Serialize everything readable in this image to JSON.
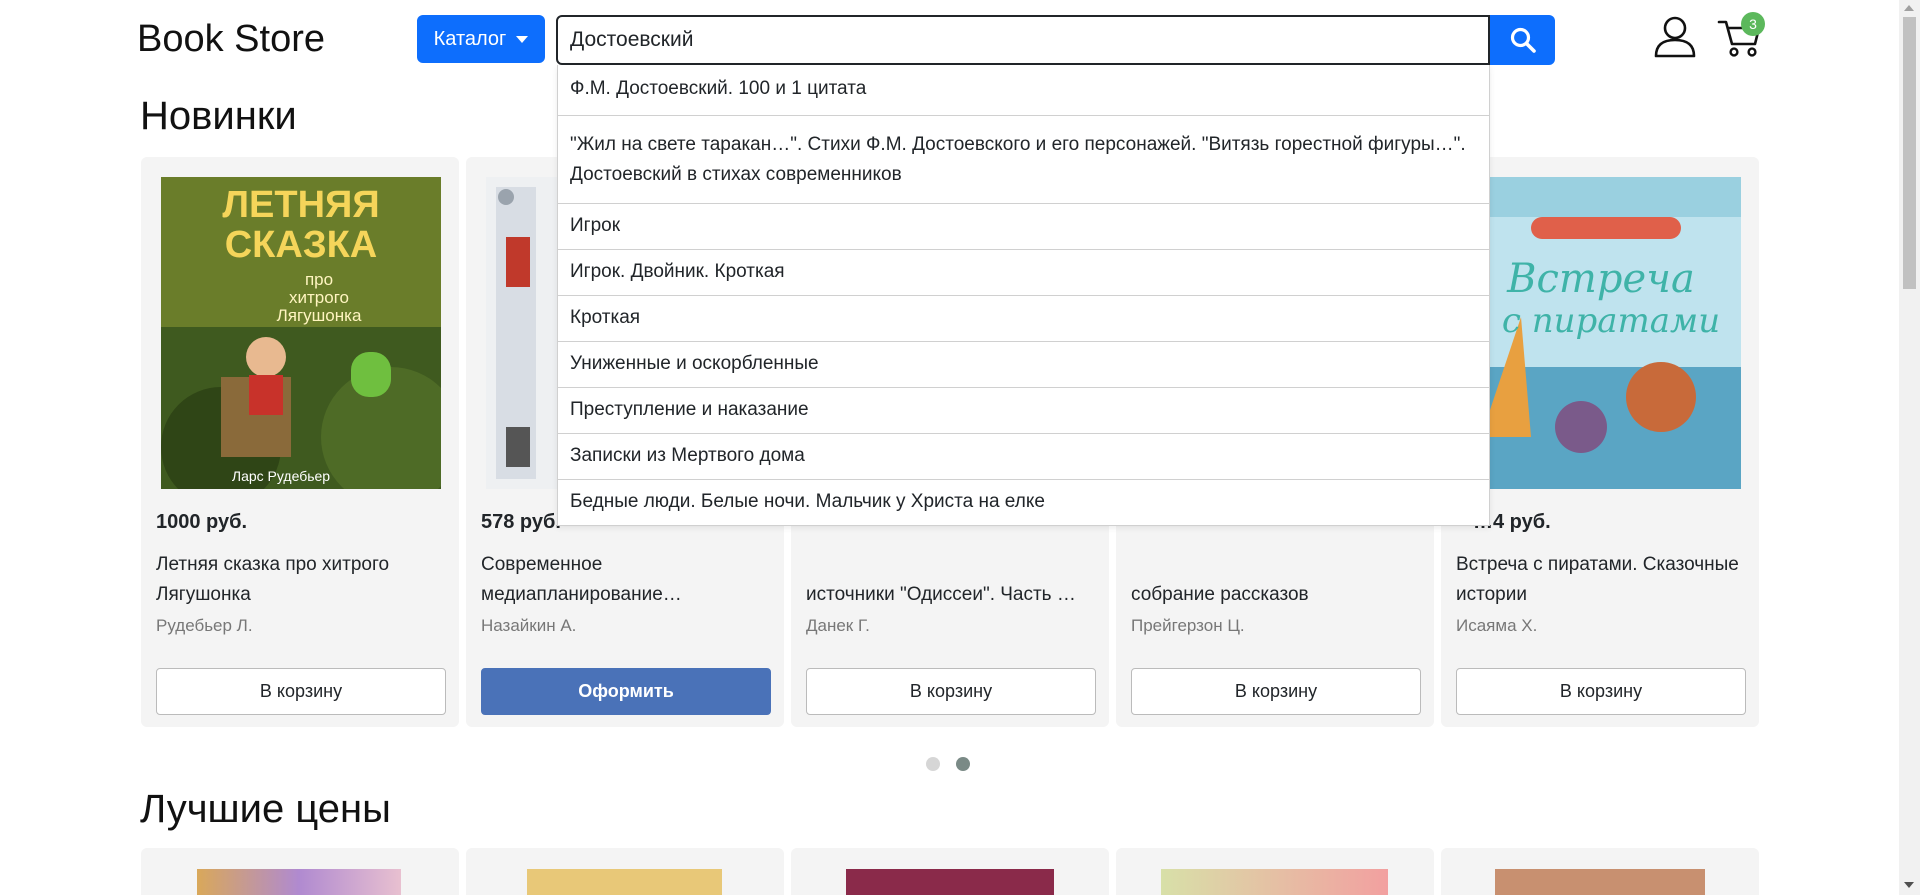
{
  "header": {
    "logo": "Book Store",
    "catalog_label": "Каталог",
    "search_value": "Достоевский",
    "cart_count": "3"
  },
  "sections": {
    "new_title": "Новинки",
    "best_prices_title": "Лучшие цены"
  },
  "products": [
    {
      "price": "1000 руб.",
      "title": "Летняя сказка про хитрого Лягушонка",
      "author": "Рудебьер Л.",
      "button": "В корзину",
      "cover_lines": [
        "ЛЕТНЯЯ",
        "СКАЗКА",
        "про",
        "хитрого",
        "Лягушонка",
        "Ларс Рудебьер"
      ]
    },
    {
      "price": "578 руб.",
      "title": "Современное медиапланирование…",
      "author": "Назайкин А.",
      "button": "Оформить"
    },
    {
      "price": "",
      "title": "",
      "author": "Данек Г.",
      "button": "В корзину"
    },
    {
      "price": "",
      "title": "",
      "author": "Прейгерзон Ц.",
      "button": "В корзину"
    },
    {
      "price": "…4 руб.",
      "title": "Встреча с пиратами. Сказочные истории",
      "author": "Исаяма Х.",
      "button": "В корзину",
      "cover_lines": [
        "Встреча",
        "с пиратами"
      ]
    }
  ],
  "partial_titles": {
    "card3": "источники \"Одиссеи\". Часть …",
    "card4": "собрание рассказов"
  },
  "suggestions": [
    "Ф.М. Достоевский. 100 и 1 цитата",
    "\"Жил на свете таракан…\". Стихи Ф.М. Достоевского и его персонажей. \"Витязь горестной фигуры…\". Достоевский в стихах современников",
    "Игрок",
    "Игрок. Двойник. Кроткая",
    "Кроткая",
    "Униженные и оскорбленные",
    "Преступление и наказание",
    "Записки из Мертвого дома",
    "Бедные люди. Белые ночи. Мальчик у Христа на елке"
  ],
  "carousel": {
    "pages": 2,
    "active_page": 2
  },
  "colors": {
    "primary": "#0d6efd",
    "badge": "#5cb85c",
    "checkout": "#4a72b8"
  },
  "icons": {
    "search": "search-icon",
    "user": "user-icon",
    "cart": "cart-icon"
  }
}
